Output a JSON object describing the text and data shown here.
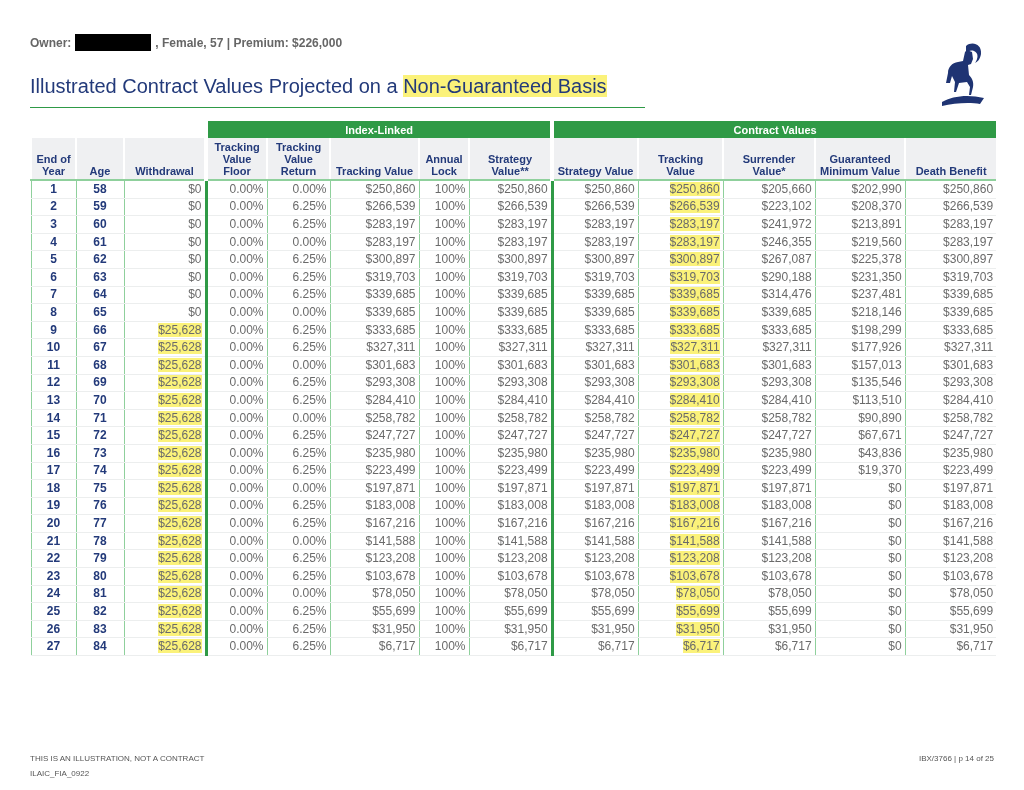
{
  "header": {
    "owner_label": "Owner:",
    "owner_redacted": true,
    "owner_details": ", Female, 57 | Premium: $226,000"
  },
  "title": {
    "text": "Illustrated Contract Values Projected on a ",
    "highlight": "Non-Guaranteed Basis"
  },
  "table": {
    "columns": [
      {
        "label": "End of Year",
        "kind": "key"
      },
      {
        "label": "Age",
        "kind": "key"
      },
      {
        "label": "Withdrawal",
        "kind": "withdrawal"
      }
    ],
    "groups": [
      {
        "label": "Index-Linked",
        "columns": [
          {
            "label": "Tracking Value Floor",
            "kind": "value"
          },
          {
            "label": "Tracking Value Return",
            "kind": "value"
          },
          {
            "label": "Tracking Value",
            "kind": "value"
          },
          {
            "label": "Annual Lock",
            "kind": "value"
          },
          {
            "label": "Strategy Value**",
            "kind": "value"
          }
        ]
      },
      {
        "label": "Contract Values",
        "columns": [
          {
            "label": "Strategy Value",
            "kind": "value"
          },
          {
            "label": "Tracking Value",
            "kind": "tracking"
          },
          {
            "label": "Surrender Value*",
            "kind": "value"
          },
          {
            "label": "Guaranteed Minimum Value",
            "kind": "value"
          },
          {
            "label": "Death Benefit",
            "kind": "value"
          }
        ]
      }
    ],
    "rows": [
      {
        "withdrawal_highlighted": false,
        "tracking_highlighted": true,
        "cells": [
          "1",
          "58",
          "$0",
          "0.00%",
          "0.00%",
          "$250,860",
          "100%",
          "$250,860",
          "$250,860",
          "$250,860",
          "$205,660",
          "$202,990",
          "$250,860"
        ]
      },
      {
        "withdrawal_highlighted": false,
        "tracking_highlighted": true,
        "cells": [
          "2",
          "59",
          "$0",
          "0.00%",
          "6.25%",
          "$266,539",
          "100%",
          "$266,539",
          "$266,539",
          "$266,539",
          "$223,102",
          "$208,370",
          "$266,539"
        ]
      },
      {
        "withdrawal_highlighted": false,
        "tracking_highlighted": true,
        "cells": [
          "3",
          "60",
          "$0",
          "0.00%",
          "6.25%",
          "$283,197",
          "100%",
          "$283,197",
          "$283,197",
          "$283,197",
          "$241,972",
          "$213,891",
          "$283,197"
        ]
      },
      {
        "withdrawal_highlighted": false,
        "tracking_highlighted": true,
        "cells": [
          "4",
          "61",
          "$0",
          "0.00%",
          "0.00%",
          "$283,197",
          "100%",
          "$283,197",
          "$283,197",
          "$283,197",
          "$246,355",
          "$219,560",
          "$283,197"
        ]
      },
      {
        "withdrawal_highlighted": false,
        "tracking_highlighted": true,
        "cells": [
          "5",
          "62",
          "$0",
          "0.00%",
          "6.25%",
          "$300,897",
          "100%",
          "$300,897",
          "$300,897",
          "$300,897",
          "$267,087",
          "$225,378",
          "$300,897"
        ]
      },
      {
        "withdrawal_highlighted": false,
        "tracking_highlighted": true,
        "cells": [
          "6",
          "63",
          "$0",
          "0.00%",
          "6.25%",
          "$319,703",
          "100%",
          "$319,703",
          "$319,703",
          "$319,703",
          "$290,188",
          "$231,350",
          "$319,703"
        ]
      },
      {
        "withdrawal_highlighted": false,
        "tracking_highlighted": true,
        "cells": [
          "7",
          "64",
          "$0",
          "0.00%",
          "6.25%",
          "$339,685",
          "100%",
          "$339,685",
          "$339,685",
          "$339,685",
          "$314,476",
          "$237,481",
          "$339,685"
        ]
      },
      {
        "withdrawal_highlighted": false,
        "tracking_highlighted": true,
        "cells": [
          "8",
          "65",
          "$0",
          "0.00%",
          "0.00%",
          "$339,685",
          "100%",
          "$339,685",
          "$339,685",
          "$339,685",
          "$339,685",
          "$218,146",
          "$339,685"
        ]
      },
      {
        "withdrawal_highlighted": true,
        "tracking_highlighted": true,
        "cells": [
          "9",
          "66",
          "$25,628",
          "0.00%",
          "6.25%",
          "$333,685",
          "100%",
          "$333,685",
          "$333,685",
          "$333,685",
          "$333,685",
          "$198,299",
          "$333,685"
        ]
      },
      {
        "withdrawal_highlighted": true,
        "tracking_highlighted": true,
        "cells": [
          "10",
          "67",
          "$25,628",
          "0.00%",
          "6.25%",
          "$327,311",
          "100%",
          "$327,311",
          "$327,311",
          "$327,311",
          "$327,311",
          "$177,926",
          "$327,311"
        ]
      },
      {
        "withdrawal_highlighted": true,
        "tracking_highlighted": true,
        "cells": [
          "11",
          "68",
          "$25,628",
          "0.00%",
          "0.00%",
          "$301,683",
          "100%",
          "$301,683",
          "$301,683",
          "$301,683",
          "$301,683",
          "$157,013",
          "$301,683"
        ]
      },
      {
        "withdrawal_highlighted": true,
        "tracking_highlighted": true,
        "cells": [
          "12",
          "69",
          "$25,628",
          "0.00%",
          "6.25%",
          "$293,308",
          "100%",
          "$293,308",
          "$293,308",
          "$293,308",
          "$293,308",
          "$135,546",
          "$293,308"
        ]
      },
      {
        "withdrawal_highlighted": true,
        "tracking_highlighted": true,
        "cells": [
          "13",
          "70",
          "$25,628",
          "0.00%",
          "6.25%",
          "$284,410",
          "100%",
          "$284,410",
          "$284,410",
          "$284,410",
          "$284,410",
          "$113,510",
          "$284,410"
        ]
      },
      {
        "withdrawal_highlighted": true,
        "tracking_highlighted": true,
        "cells": [
          "14",
          "71",
          "$25,628",
          "0.00%",
          "0.00%",
          "$258,782",
          "100%",
          "$258,782",
          "$258,782",
          "$258,782",
          "$258,782",
          "$90,890",
          "$258,782"
        ]
      },
      {
        "withdrawal_highlighted": true,
        "tracking_highlighted": true,
        "cells": [
          "15",
          "72",
          "$25,628",
          "0.00%",
          "6.25%",
          "$247,727",
          "100%",
          "$247,727",
          "$247,727",
          "$247,727",
          "$247,727",
          "$67,671",
          "$247,727"
        ]
      },
      {
        "withdrawal_highlighted": true,
        "tracking_highlighted": true,
        "cells": [
          "16",
          "73",
          "$25,628",
          "0.00%",
          "6.25%",
          "$235,980",
          "100%",
          "$235,980",
          "$235,980",
          "$235,980",
          "$235,980",
          "$43,836",
          "$235,980"
        ]
      },
      {
        "withdrawal_highlighted": true,
        "tracking_highlighted": true,
        "cells": [
          "17",
          "74",
          "$25,628",
          "0.00%",
          "6.25%",
          "$223,499",
          "100%",
          "$223,499",
          "$223,499",
          "$223,499",
          "$223,499",
          "$19,370",
          "$223,499"
        ]
      },
      {
        "withdrawal_highlighted": true,
        "tracking_highlighted": true,
        "cells": [
          "18",
          "75",
          "$25,628",
          "0.00%",
          "0.00%",
          "$197,871",
          "100%",
          "$197,871",
          "$197,871",
          "$197,871",
          "$197,871",
          "$0",
          "$197,871"
        ]
      },
      {
        "withdrawal_highlighted": true,
        "tracking_highlighted": true,
        "cells": [
          "19",
          "76",
          "$25,628",
          "0.00%",
          "6.25%",
          "$183,008",
          "100%",
          "$183,008",
          "$183,008",
          "$183,008",
          "$183,008",
          "$0",
          "$183,008"
        ]
      },
      {
        "withdrawal_highlighted": true,
        "tracking_highlighted": true,
        "cells": [
          "20",
          "77",
          "$25,628",
          "0.00%",
          "6.25%",
          "$167,216",
          "100%",
          "$167,216",
          "$167,216",
          "$167,216",
          "$167,216",
          "$0",
          "$167,216"
        ]
      },
      {
        "withdrawal_highlighted": true,
        "tracking_highlighted": true,
        "cells": [
          "21",
          "78",
          "$25,628",
          "0.00%",
          "0.00%",
          "$141,588",
          "100%",
          "$141,588",
          "$141,588",
          "$141,588",
          "$141,588",
          "$0",
          "$141,588"
        ]
      },
      {
        "withdrawal_highlighted": true,
        "tracking_highlighted": true,
        "cells": [
          "22",
          "79",
          "$25,628",
          "0.00%",
          "6.25%",
          "$123,208",
          "100%",
          "$123,208",
          "$123,208",
          "$123,208",
          "$123,208",
          "$0",
          "$123,208"
        ]
      },
      {
        "withdrawal_highlighted": true,
        "tracking_highlighted": true,
        "cells": [
          "23",
          "80",
          "$25,628",
          "0.00%",
          "6.25%",
          "$103,678",
          "100%",
          "$103,678",
          "$103,678",
          "$103,678",
          "$103,678",
          "$0",
          "$103,678"
        ]
      },
      {
        "withdrawal_highlighted": true,
        "tracking_highlighted": true,
        "cells": [
          "24",
          "81",
          "$25,628",
          "0.00%",
          "0.00%",
          "$78,050",
          "100%",
          "$78,050",
          "$78,050",
          "$78,050",
          "$78,050",
          "$0",
          "$78,050"
        ]
      },
      {
        "withdrawal_highlighted": true,
        "tracking_highlighted": true,
        "cells": [
          "25",
          "82",
          "$25,628",
          "0.00%",
          "6.25%",
          "$55,699",
          "100%",
          "$55,699",
          "$55,699",
          "$55,699",
          "$55,699",
          "$0",
          "$55,699"
        ]
      },
      {
        "withdrawal_highlighted": true,
        "tracking_highlighted": true,
        "cells": [
          "26",
          "83",
          "$25,628",
          "0.00%",
          "6.25%",
          "$31,950",
          "100%",
          "$31,950",
          "$31,950",
          "$31,950",
          "$31,950",
          "$0",
          "$31,950"
        ]
      },
      {
        "withdrawal_highlighted": true,
        "tracking_highlighted": true,
        "cells": [
          "27",
          "84",
          "$25,628",
          "0.00%",
          "6.25%",
          "$6,717",
          "100%",
          "$6,717",
          "$6,717",
          "$6,717",
          "$6,717",
          "$0",
          "$6,717"
        ]
      }
    ]
  },
  "footer": {
    "left": [
      "THIS IS AN ILLUSTRATION, NOT A CONTRACT",
      "ILAIC_FIA_0922"
    ],
    "right": "IBX/3766 | p 14 of 25"
  }
}
